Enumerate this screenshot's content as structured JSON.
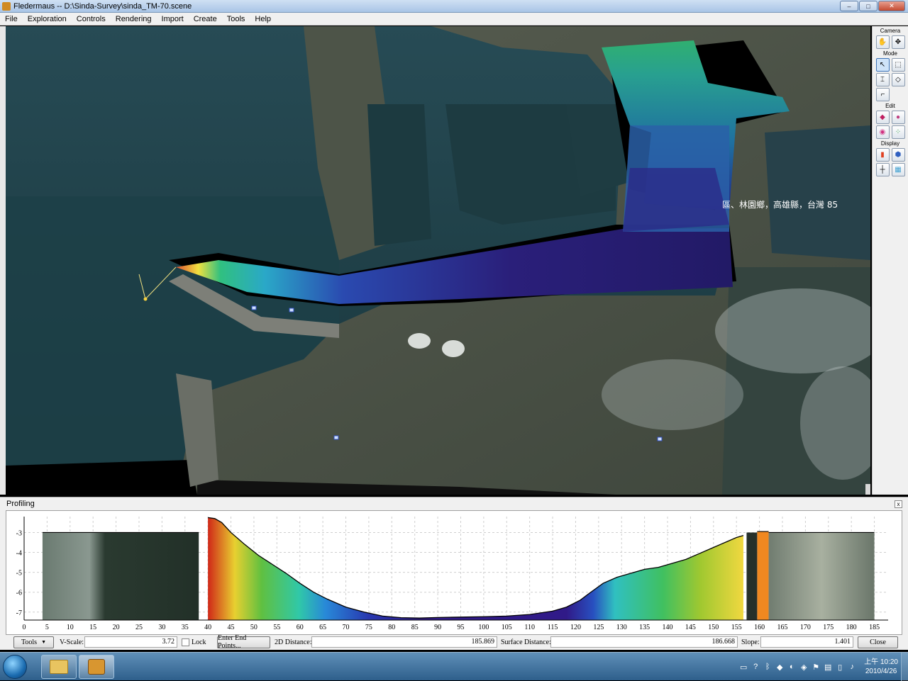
{
  "window": {
    "title": "Fledermaus -- D:\\Sinda-Survey\\sinda_TM-70.scene",
    "minimize": "–",
    "maximize": "□",
    "close": "✕"
  },
  "menu": [
    "File",
    "Exploration",
    "Controls",
    "Rendering",
    "Import",
    "Create",
    "Tools",
    "Help"
  ],
  "viewport": {
    "map_label": "區、林園鄉，高雄縣，台灣 85"
  },
  "right_panel": {
    "sections": [
      "Camera",
      "Mode",
      "Edit",
      "Display"
    ],
    "icons": [
      "camera-rotate-icon",
      "camera-pan-icon",
      "select-pointer-icon",
      "region-select-icon",
      "probe-icon",
      "measure-icon",
      "line-tool-icon",
      "edit-surface-icon",
      "edit-points-icon",
      "edit-brush-icon",
      "edit-colors-icon",
      "colormap-icon",
      "shading-icon",
      "axes-icon",
      "grid-display-icon"
    ]
  },
  "profiling": {
    "title": "Profiling",
    "close": "x",
    "x_ticks": [
      "0",
      "5",
      "10",
      "15",
      "20",
      "25",
      "30",
      "35",
      "40",
      "45",
      "50",
      "55",
      "60",
      "65",
      "70",
      "75",
      "80",
      "85",
      "90",
      "95",
      "100",
      "105",
      "110",
      "115",
      "120",
      "125",
      "130",
      "135",
      "140",
      "145",
      "150",
      "155",
      "160",
      "165",
      "170",
      "175",
      "180",
      "185"
    ],
    "y_ticks": [
      "-3",
      "-4",
      "-5",
      "-6",
      "-7"
    ],
    "tools_label": "Tools",
    "vscale_label": "V-Scale:",
    "vscale_value": "3.72",
    "lock_label": "Lock",
    "endpoints_label": "Enter End Points...",
    "dist2d_label": "2D Distance:",
    "dist2d_value": "185.869",
    "surface_label": "Surface Distance:",
    "surface_value": "186.668",
    "slope_label": "Slope:",
    "slope_value": "1.401",
    "close_label": "Close"
  },
  "taskbar": {
    "time": "上午 10:20",
    "date": "2010/4/26"
  },
  "chart_data": {
    "type": "area",
    "title": "",
    "xlabel": "",
    "ylabel": "",
    "xlim": [
      0,
      188
    ],
    "ylim": [
      -7.4,
      -2.2
    ],
    "x_ticks": [
      0,
      5,
      10,
      15,
      20,
      25,
      30,
      35,
      40,
      45,
      50,
      55,
      60,
      65,
      70,
      75,
      80,
      85,
      90,
      95,
      100,
      105,
      110,
      115,
      120,
      125,
      130,
      135,
      140,
      145,
      150,
      155,
      160,
      165,
      170,
      175,
      180,
      185
    ],
    "y_ticks": [
      -3,
      -4,
      -5,
      -6,
      -7
    ],
    "grid": true,
    "series": [
      {
        "x": [
          40,
          41.5,
          43,
          45,
          48,
          51,
          54,
          57,
          60,
          63,
          66,
          70,
          74,
          78,
          82,
          86,
          90,
          95,
          100,
          105,
          110,
          115,
          118,
          121,
          123,
          126,
          129,
          132,
          135,
          138,
          141,
          144,
          147,
          150,
          153,
          155,
          156.5
        ],
        "y": [
          -2.25,
          -2.3,
          -2.5,
          -3.0,
          -3.6,
          -4.15,
          -4.6,
          -5.05,
          -5.55,
          -6.0,
          -6.35,
          -6.75,
          -7.0,
          -7.2,
          -7.28,
          -7.3,
          -7.27,
          -7.25,
          -7.23,
          -7.2,
          -7.12,
          -6.95,
          -6.75,
          -6.4,
          -6.05,
          -5.55,
          -5.25,
          -5.05,
          -4.85,
          -4.75,
          -4.55,
          -4.35,
          -4.05,
          -3.75,
          -3.45,
          -3.25,
          -3.15
        ]
      }
    ],
    "segments": [
      {
        "x": [
          4,
          38
        ],
        "y": -3.0
      },
      {
        "x": [
          159.5,
          162
        ],
        "y": -2.95
      },
      {
        "x": [
          162,
          185
        ],
        "y": -3.0
      }
    ]
  }
}
